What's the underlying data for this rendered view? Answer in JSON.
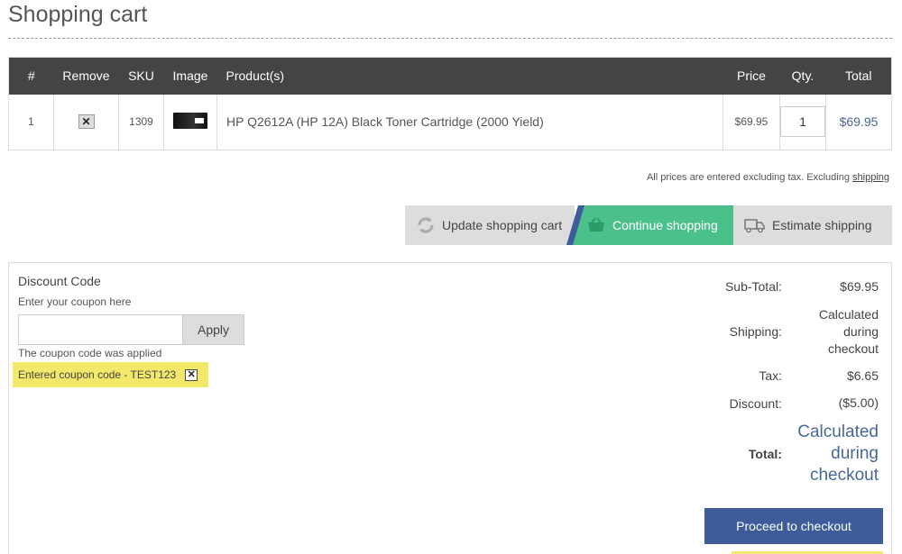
{
  "page": {
    "title": "Shopping cart"
  },
  "table": {
    "headers": [
      "#",
      "Remove",
      "SKU",
      "Image",
      "Product(s)",
      "Price",
      "Qty.",
      "Total"
    ],
    "row": {
      "index": "1",
      "remove": "✕",
      "sku": "1309",
      "product": "HP Q2612A (HP 12A) Black Toner Cartridge (2000 Yield)",
      "price": "$69.95",
      "qty": "1",
      "total": "$69.95"
    }
  },
  "tax_note": {
    "text": "All prices are entered excluding tax. Excluding ",
    "link": "shipping"
  },
  "buttons": {
    "update": "Update shopping cart",
    "continue": "Continue shopping",
    "estimate": "Estimate shipping"
  },
  "discount": {
    "title": "Discount Code",
    "hint": "Enter your coupon here",
    "input_value": "",
    "apply": "Apply",
    "applied_msg": "The coupon code was applied",
    "coupon_tag": "Entered coupon code - TEST123"
  },
  "totals": {
    "subtotal_label": "Sub-Total:",
    "subtotal": "$69.95",
    "shipping_label": "Shipping:",
    "shipping_l1": "Calculated",
    "shipping_l2": "during",
    "shipping_l3": "checkout",
    "tax_label": "Tax:",
    "tax": "$6.65",
    "discount_label": "Discount:",
    "discount": "($5.00)",
    "total_label": "Total:",
    "total_l1": "Calculated",
    "total_l2": "during",
    "total_l3": "checkout"
  },
  "checkout": {
    "label": "Proceed to checkout"
  },
  "colors": {
    "header": "#444444",
    "continue": "#4cc08a",
    "primary": "#3e5c99",
    "highlight": "#f3e86a",
    "link": "#4a6796"
  }
}
